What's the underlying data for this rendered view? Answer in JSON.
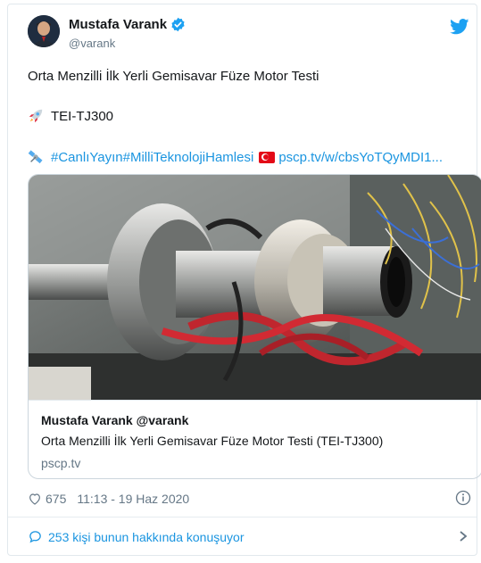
{
  "author": {
    "display_name": "Mustafa Varank",
    "handle": "@varank"
  },
  "tweet": {
    "line1": "Orta Menzilli İlk Yerli Gemisavar Füze Motor Testi",
    "line2": "TEI-TJ300",
    "hashtags": "#CanlıYayın#MilliTeknolojiHamlesi",
    "link": "pscp.tv/w/cbsYoTQyMDI1..."
  },
  "media_card": {
    "title": "Mustafa Varank @varank",
    "description": "Orta Menzilli İlk Yerli Gemisavar Füze Motor Testi (TEI-TJ300)",
    "domain": "pscp.tv"
  },
  "footer": {
    "likes": "675",
    "timestamp": "11:13 - 19 Haz 2020"
  },
  "conversation": {
    "label": "253 kişi bunun hakkında konuşuyor"
  },
  "colors": {
    "link": "#1b95e0",
    "muted": "#657786",
    "border": "#e1e8ed"
  },
  "icons": [
    "verified-badge-icon",
    "twitter-bird-icon",
    "rocket-icon",
    "satellite-icon",
    "turkey-flag-icon",
    "heart-icon",
    "info-icon",
    "comment-bubble-icon",
    "chevron-right-icon"
  ]
}
